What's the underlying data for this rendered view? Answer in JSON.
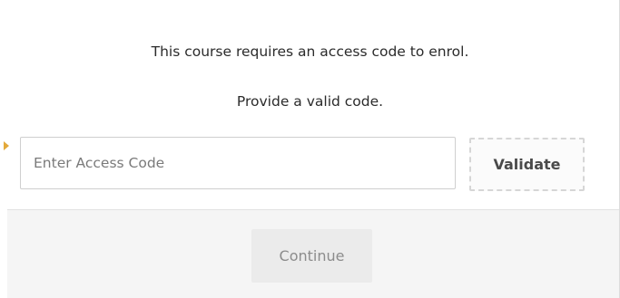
{
  "dialog": {
    "message_line1": "This course requires an access code to enrol.",
    "message_line2": "Provide a valid code.",
    "access_code": {
      "value": "",
      "placeholder": "Enter Access Code"
    },
    "validate_label": "Validate",
    "continue_label": "Continue"
  },
  "colors": {
    "text": "#2b2b2b",
    "placeholder": "#7a7a7a",
    "footer_bg": "#f5f5f5",
    "button_disabled_bg": "#ebebeb",
    "button_disabled_text": "#8c8c8c",
    "marker": "#e3a93a"
  }
}
